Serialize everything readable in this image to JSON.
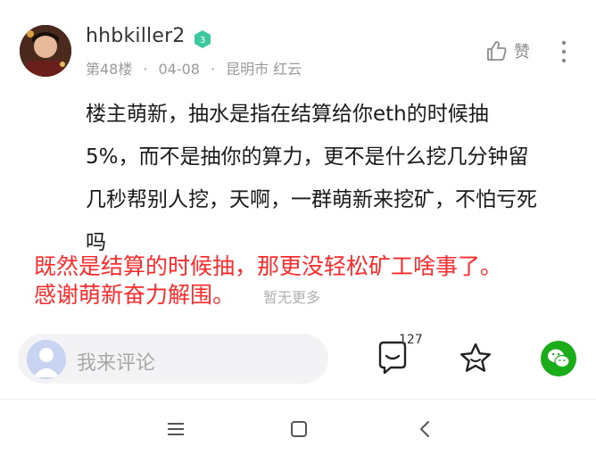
{
  "post": {
    "username": "hhbkiller2",
    "level": "3",
    "floor": "第48楼",
    "date": "04-08",
    "location": "昆明市 红云",
    "like_label": "赞",
    "content_lines": [
      "楼主萌新，抽水是指在结算给你eth的时候抽",
      "5%，而不是抽你的算力，更不是什么挖几分钟留",
      "几秒帮别人挖，天啊，一群萌新来挖矿，不怕亏死",
      "吗"
    ]
  },
  "overlay_text": [
    "既然是结算的时候抽，那更没轻松矿工啥事了。",
    "感谢萌新奋力解围。"
  ],
  "no_more": "暂无更多",
  "comment_bar": {
    "placeholder": "我来评论",
    "comment_count": "127"
  },
  "colors": {
    "overlay_red": "#ff2a2a",
    "level_badge": "#3cc9a0",
    "wechat_green": "#1aad19"
  },
  "icons": [
    "thumbs-up-icon",
    "more-vertical-icon",
    "comment-icon",
    "star-icon",
    "wechat-icon",
    "menu-icon",
    "home-square-icon",
    "back-chevron-icon"
  ]
}
